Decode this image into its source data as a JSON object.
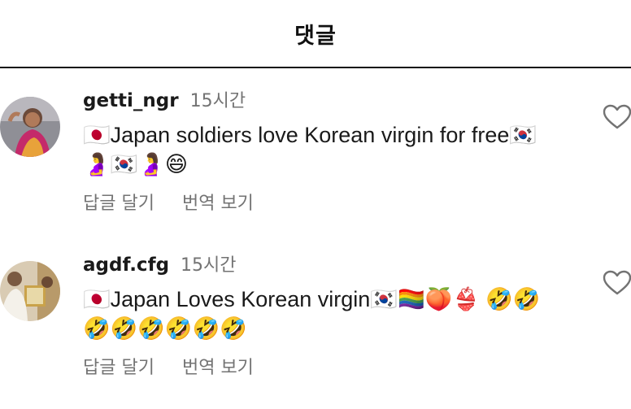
{
  "header": {
    "title": "댓글"
  },
  "comments": [
    {
      "username": "getti_ngr",
      "time": "15시간",
      "text_line1": "🇯🇵Japan soldiers love Korean virgin for free🇰🇷",
      "text_line2": "🤰🇰🇷🤰😄",
      "reply_label": "답글 달기",
      "translate_label": "번역 보기"
    },
    {
      "username": "agdf.cfg",
      "time": "15시간",
      "text_line1": "🇯🇵Japan Loves Korean virgin🇰🇷🏳️‍🌈🍑👙 🤣🤣",
      "text_line2": "🤣🤣🤣🤣🤣🤣",
      "reply_label": "답글 달기",
      "translate_label": "번역 보기"
    }
  ],
  "icons": {
    "like": "heart-outline-icon"
  },
  "colors": {
    "secondary_text": "#737373",
    "primary_text": "#1a1a1a"
  }
}
